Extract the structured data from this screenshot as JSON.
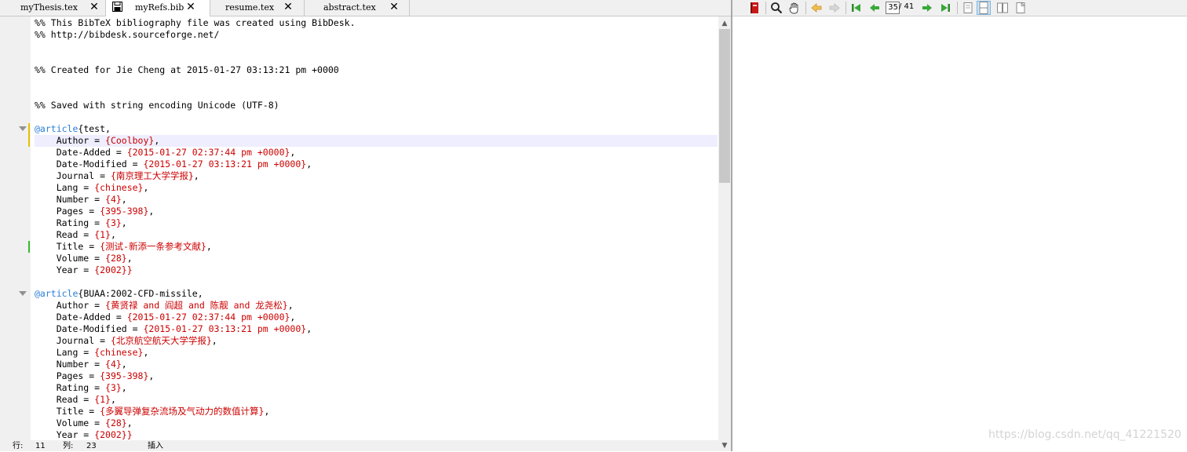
{
  "tabs": [
    {
      "label": "myThesis.tex",
      "active": false
    },
    {
      "label": "myRefs.bib",
      "active": true
    },
    {
      "label": "resume.tex",
      "active": false
    },
    {
      "label": "abstract.tex",
      "active": false
    }
  ],
  "editor": {
    "lines": [
      [
        {
          "t": "%% This BibTeX bibliography file was created using BibDesk."
        }
      ],
      [
        {
          "t": "%% http://bibdesk.sourceforge.net/"
        }
      ],
      [
        {
          "t": ""
        }
      ],
      [
        {
          "t": ""
        }
      ],
      [
        {
          "t": "%% Created for Jie Cheng at 2015-01-27 03:13:21 pm +0000"
        }
      ],
      [
        {
          "t": ""
        }
      ],
      [
        {
          "t": ""
        }
      ],
      [
        {
          "t": "%% Saved with string encoding Unicode (UTF-8)"
        }
      ],
      [
        {
          "t": ""
        }
      ],
      [
        {
          "t": "@article",
          "c": "at"
        },
        {
          "t": "{test,"
        }
      ],
      [
        {
          "t": "    Author = "
        },
        {
          "t": "{Coolboy}",
          "c": "val"
        },
        {
          "t": ","
        }
      ],
      [
        {
          "t": "    Date-Added = "
        },
        {
          "t": "{2015-01-27 02:37:44 pm +0000}",
          "c": "val"
        },
        {
          "t": ","
        }
      ],
      [
        {
          "t": "    Date-Modified = "
        },
        {
          "t": "{2015-01-27 03:13:21 pm +0000}",
          "c": "val"
        },
        {
          "t": ","
        }
      ],
      [
        {
          "t": "    Journal = "
        },
        {
          "t": "{南京理工大学学报}",
          "c": "val"
        },
        {
          "t": ","
        }
      ],
      [
        {
          "t": "    Lang = "
        },
        {
          "t": "{chinese}",
          "c": "val"
        },
        {
          "t": ","
        }
      ],
      [
        {
          "t": "    Number = "
        },
        {
          "t": "{4}",
          "c": "val"
        },
        {
          "t": ","
        }
      ],
      [
        {
          "t": "    Pages = "
        },
        {
          "t": "{395-398}",
          "c": "val"
        },
        {
          "t": ","
        }
      ],
      [
        {
          "t": "    Rating = "
        },
        {
          "t": "{3}",
          "c": "val"
        },
        {
          "t": ","
        }
      ],
      [
        {
          "t": "    Read = "
        },
        {
          "t": "{1}",
          "c": "val"
        },
        {
          "t": ","
        }
      ],
      [
        {
          "t": "    Title = "
        },
        {
          "t": "{测试-新添一条参考文献}",
          "c": "val"
        },
        {
          "t": ","
        }
      ],
      [
        {
          "t": "    Volume = "
        },
        {
          "t": "{28}",
          "c": "val"
        },
        {
          "t": ","
        }
      ],
      [
        {
          "t": "    Year = "
        },
        {
          "t": "{2002}}",
          "c": "val"
        }
      ],
      [
        {
          "t": ""
        }
      ],
      [
        {
          "t": "@article",
          "c": "at"
        },
        {
          "t": "{BUAA:2002-CFD-missile,"
        }
      ],
      [
        {
          "t": "    Author = "
        },
        {
          "t": "{黄贤禄 and 阎超 and 陈靓 and 龙尧松}",
          "c": "val"
        },
        {
          "t": ","
        }
      ],
      [
        {
          "t": "    Date-Added = "
        },
        {
          "t": "{2015-01-27 02:37:44 pm +0000}",
          "c": "val"
        },
        {
          "t": ","
        }
      ],
      [
        {
          "t": "    Date-Modified = "
        },
        {
          "t": "{2015-01-27 03:13:21 pm +0000}",
          "c": "val"
        },
        {
          "t": ","
        }
      ],
      [
        {
          "t": "    Journal = "
        },
        {
          "t": "{北京航空航天大学学报}",
          "c": "val"
        },
        {
          "t": ","
        }
      ],
      [
        {
          "t": "    Lang = "
        },
        {
          "t": "{chinese}",
          "c": "val"
        },
        {
          "t": ","
        }
      ],
      [
        {
          "t": "    Number = "
        },
        {
          "t": "{4}",
          "c": "val"
        },
        {
          "t": ","
        }
      ],
      [
        {
          "t": "    Pages = "
        },
        {
          "t": "{395-398}",
          "c": "val"
        },
        {
          "t": ","
        }
      ],
      [
        {
          "t": "    Rating = "
        },
        {
          "t": "{3}",
          "c": "val"
        },
        {
          "t": ","
        }
      ],
      [
        {
          "t": "    Read = "
        },
        {
          "t": "{1}",
          "c": "val"
        },
        {
          "t": ","
        }
      ],
      [
        {
          "t": "    Title = "
        },
        {
          "t": "{多翼导弹复杂流场及气动力的数值计算}",
          "c": "val"
        },
        {
          "t": ","
        }
      ],
      [
        {
          "t": "    Volume = "
        },
        {
          "t": "{28}",
          "c": "val"
        },
        {
          "t": ","
        }
      ],
      [
        {
          "t": "    Year = "
        },
        {
          "t": "{2002}}",
          "c": "val"
        }
      ]
    ],
    "current_line_index": 10,
    "fold_marker_lines": [
      9,
      23
    ],
    "change_marks": [
      {
        "line": 9,
        "color": "#e8c000"
      },
      {
        "line": 10,
        "color": "#e8c000"
      },
      {
        "line": 19,
        "color": "#33bb33"
      }
    ]
  },
  "status": {
    "row_label": "行:",
    "row_value": "11",
    "col_label": "列:",
    "col_value": "23",
    "mode": "插入"
  },
  "viewer": {
    "current_page": "35",
    "total_pages": "/ 41",
    "toolbar_icons": [
      "book-icon",
      "magnifier-icon",
      "hand-icon",
      "history-back-icon",
      "history-forward-icon",
      "first-page-icon",
      "previous-page-icon",
      "next-page-icon",
      "last-page-icon",
      "single-page-icon",
      "continuous-page-icon",
      "facing-pages-icon",
      "continuous-facing-icon"
    ]
  },
  "watermark": "https://blog.csdn.net/qq_41221520",
  "colors": {
    "keyword": "#2a7fd8",
    "value": "#cc0000",
    "current_line": "#eeeeff"
  }
}
